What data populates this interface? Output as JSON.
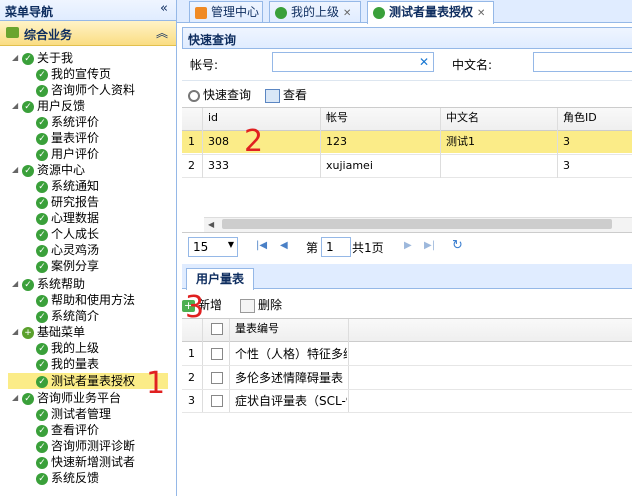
{
  "nav": {
    "title": "菜单导航",
    "panel_title": "综合业务",
    "groups": [
      {
        "label": "关于我",
        "items": [
          "我的宣传页",
          "咨询师个人资料"
        ]
      },
      {
        "label": "用户反馈",
        "items": [
          "系统评价",
          "量表评价",
          "用户评价"
        ]
      },
      {
        "label": "资源中心",
        "items": [
          "系统通知",
          "研究报告",
          "心理数据",
          "个人成长",
          "心灵鸡汤",
          "案例分享"
        ]
      },
      {
        "label": "系统帮助",
        "items": [
          "帮助和使用方法",
          "系统简介"
        ]
      },
      {
        "label": "基础菜单",
        "items": [
          "我的上级",
          "我的量表",
          "测试者量表授权"
        ]
      },
      {
        "label": "咨询师业务平台",
        "items": [
          "测试者管理",
          "查看评价",
          "咨询师测评诊断",
          "快速新增测试者",
          "系统反馈"
        ]
      }
    ]
  },
  "tabs": [
    {
      "label": "管理中心",
      "closable": false
    },
    {
      "label": "我的上级",
      "closable": true
    },
    {
      "label": "测试者量表授权",
      "closable": true
    }
  ],
  "quick_query": {
    "title": "快速查询",
    "account_label": "帐号:",
    "account_value": "",
    "clear_symbol": "✕",
    "cnname_label": "中文名:",
    "cnname_value": "",
    "search_btn": "快速查询",
    "view_btn": "查看"
  },
  "user_grid": {
    "columns": [
      "id",
      "帐号",
      "中文名",
      "角色ID"
    ],
    "rows": [
      {
        "n": "1",
        "id": "308",
        "account": "123",
        "cnname": "测试1",
        "role": "3"
      },
      {
        "n": "2",
        "id": "333",
        "account": "xujiamei",
        "cnname": "",
        "role": "3"
      }
    ]
  },
  "pager": {
    "page_size": "15",
    "page_prefix": "第",
    "page": "1",
    "page_suffix": "共1页"
  },
  "scale_panel": {
    "tab": "用户量表",
    "add_btn": "新增",
    "delete_btn": "删除",
    "column": "量表编号",
    "rows": [
      {
        "n": "1",
        "name": "个性（人格）特征多维"
      },
      {
        "n": "2",
        "name": "多伦多述情障碍量表"
      },
      {
        "n": "3",
        "name": "症状自评量表（SCL-9"
      }
    ]
  },
  "annotations": [
    "1",
    "2",
    "3"
  ],
  "colors": {
    "accent_border": "#95b8e7",
    "selected_row": "#fbec88",
    "annotation": "#e02020"
  }
}
